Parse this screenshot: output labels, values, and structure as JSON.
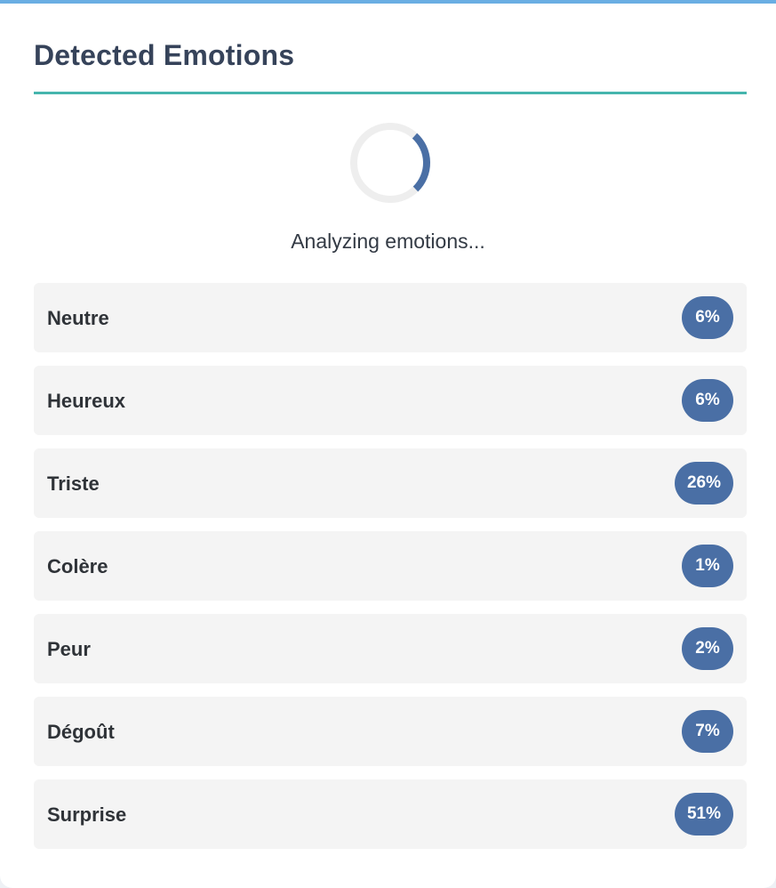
{
  "header": {
    "title": "Detected Emotions"
  },
  "status": {
    "text": "Analyzing emotions..."
  },
  "colors": {
    "accent_top": "#6aaee3",
    "rule": "#45b5ad",
    "badge": "#4a6fa5",
    "row_bg": "#f4f4f4"
  },
  "emotions": [
    {
      "label": "Neutre",
      "percent": "6%"
    },
    {
      "label": "Heureux",
      "percent": "6%"
    },
    {
      "label": "Triste",
      "percent": "26%"
    },
    {
      "label": "Colère",
      "percent": "1%"
    },
    {
      "label": "Peur",
      "percent": "2%"
    },
    {
      "label": "Dégoût",
      "percent": "7%"
    },
    {
      "label": "Surprise",
      "percent": "51%"
    }
  ]
}
